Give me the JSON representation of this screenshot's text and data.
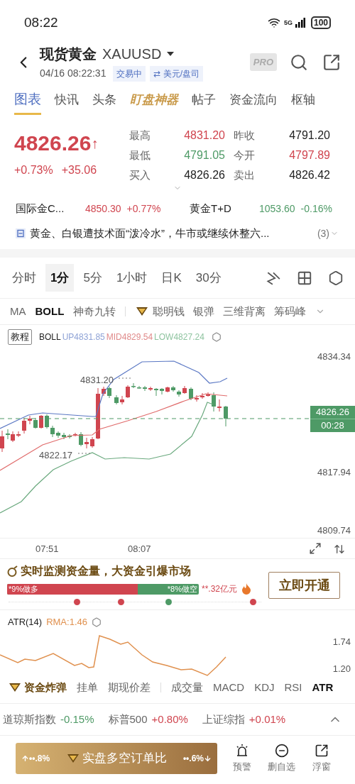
{
  "status_bar": {
    "time": "08:22",
    "network": "5G",
    "battery": "100"
  },
  "header": {
    "title": "现货黄金",
    "symbol": "XAUUSD",
    "timestamp": "04/16 08:22:31",
    "badges": [
      "交易中",
      "⇄ 美元/盘司"
    ],
    "pro": "PRO"
  },
  "tabs": [
    {
      "label": "图表",
      "selected": true,
      "kind": "plain"
    },
    {
      "label": "快讯",
      "selected": false,
      "kind": "plain"
    },
    {
      "label": "头条",
      "selected": false,
      "kind": "plain"
    },
    {
      "label": "盯盘神器",
      "selected": false,
      "kind": "featured"
    },
    {
      "label": "帖子",
      "selected": false,
      "kind": "plain"
    },
    {
      "label": "资金流向",
      "selected": false,
      "kind": "plain"
    },
    {
      "label": "枢轴",
      "selected": false,
      "kind": "plain"
    }
  ],
  "quote": {
    "price": "4826.26",
    "arrow": "↑",
    "color": "#d0454f",
    "change_pct": "+0.73%",
    "change": "+35.06",
    "stats": [
      {
        "label": "最高",
        "value": "4831.20",
        "color": "#d0454f"
      },
      {
        "label": "昨收",
        "value": "4791.20",
        "color": "#222222"
      },
      {
        "label": "最低",
        "value": "4791.05",
        "color": "#4e9a66"
      },
      {
        "label": "今开",
        "value": "4797.89",
        "color": "#d0454f"
      },
      {
        "label": "买入",
        "value": "4826.26",
        "color": "#222222"
      },
      {
        "label": "卖出",
        "value": "4826.42",
        "color": "#222222"
      }
    ]
  },
  "related": [
    {
      "name": "国际金C...",
      "price": "4850.30",
      "change": "+0.77%",
      "color": "#d0454f"
    },
    {
      "name": "黄金T+D",
      "price": "1053.60",
      "change": "-0.16%",
      "color": "#4e9a66"
    }
  ],
  "news": {
    "headline": "黄金、白银遭技术面“泼冷水”，牛市或继续休整六...",
    "count": "(3)"
  },
  "periods": [
    {
      "label": "分时",
      "selected": false
    },
    {
      "label": "1分",
      "selected": true
    },
    {
      "label": "5分",
      "selected": false
    },
    {
      "label": "1小时",
      "selected": false
    },
    {
      "label": "日K",
      "selected": false
    },
    {
      "label": "30分",
      "selected": false
    }
  ],
  "main_indicators": [
    {
      "label": "MA",
      "selected": false
    },
    {
      "label": "BOLL",
      "selected": true
    },
    {
      "label": "神奇九转",
      "selected": false
    }
  ],
  "premium_indicators": [
    {
      "label": "聪明钱",
      "kind": "premium"
    },
    {
      "label": "银弹",
      "kind": "plain"
    },
    {
      "label": "三维背离",
      "kind": "plain"
    },
    {
      "label": "筹码峰",
      "kind": "plain"
    }
  ],
  "chart": {
    "tutorial": "教程",
    "legend": {
      "name": "BOLL",
      "up": "UP4831.85",
      "mid": "MID4829.54",
      "low": "LOW4827.24"
    },
    "y_labels": [
      "4834.34",
      "4817.94",
      "4809.74"
    ],
    "high_marker": "4831.20",
    "low_marker": "4822.17",
    "last_price": "4826.26",
    "countdown": "00:28",
    "x_labels": [
      "07:51",
      "08:07"
    ]
  },
  "promo": {
    "title": "实时监测资金量，大资金引爆市场",
    "long_label": "*9%做多",
    "short_label": "*8%做空",
    "level": 0.68,
    "amount": "**.32亿元",
    "button": "立即开通",
    "markers": [
      {
        "color": "#d0454f"
      },
      {
        "color": "#d0454f"
      },
      {
        "color": "#4e9a66"
      },
      {
        "color": "#d0454f"
      }
    ]
  },
  "atr": {
    "title": "ATR(14)",
    "rma": "RMA:1.46",
    "y_labels": [
      "1.74",
      "1.20"
    ]
  },
  "bottom_tabs": [
    {
      "label": "资金炸弹",
      "selected": false,
      "kind": "premium"
    },
    {
      "label": "挂单",
      "selected": false,
      "kind": "plain"
    },
    {
      "label": "期现价差",
      "selected": false,
      "kind": "plain"
    },
    {
      "label": "成交量",
      "selected": false,
      "kind": "divided"
    },
    {
      "label": "MACD",
      "selected": false,
      "kind": "plain"
    },
    {
      "label": "KDJ",
      "selected": false,
      "kind": "plain"
    },
    {
      "label": "RSI",
      "selected": false,
      "kind": "plain"
    },
    {
      "label": "ATR",
      "selected": true,
      "kind": "plain"
    }
  ],
  "indices": [
    {
      "name": "道琼斯指数",
      "change": "-0.15%",
      "color": "#4e9a66"
    },
    {
      "name": "标普500",
      "change": "+0.80%",
      "color": "#d0454f"
    },
    {
      "name": "上证综指",
      "change": "+0.01%",
      "color": "#d0454f"
    }
  ],
  "bottom_bar": {
    "long": "••.8%",
    "label": "实盘多空订单比",
    "short": "••.6%",
    "actions": [
      {
        "label": "预警",
        "kind": "alert"
      },
      {
        "label": "删自选",
        "kind": "remove"
      },
      {
        "label": "浮窗",
        "kind": "float"
      }
    ]
  }
}
